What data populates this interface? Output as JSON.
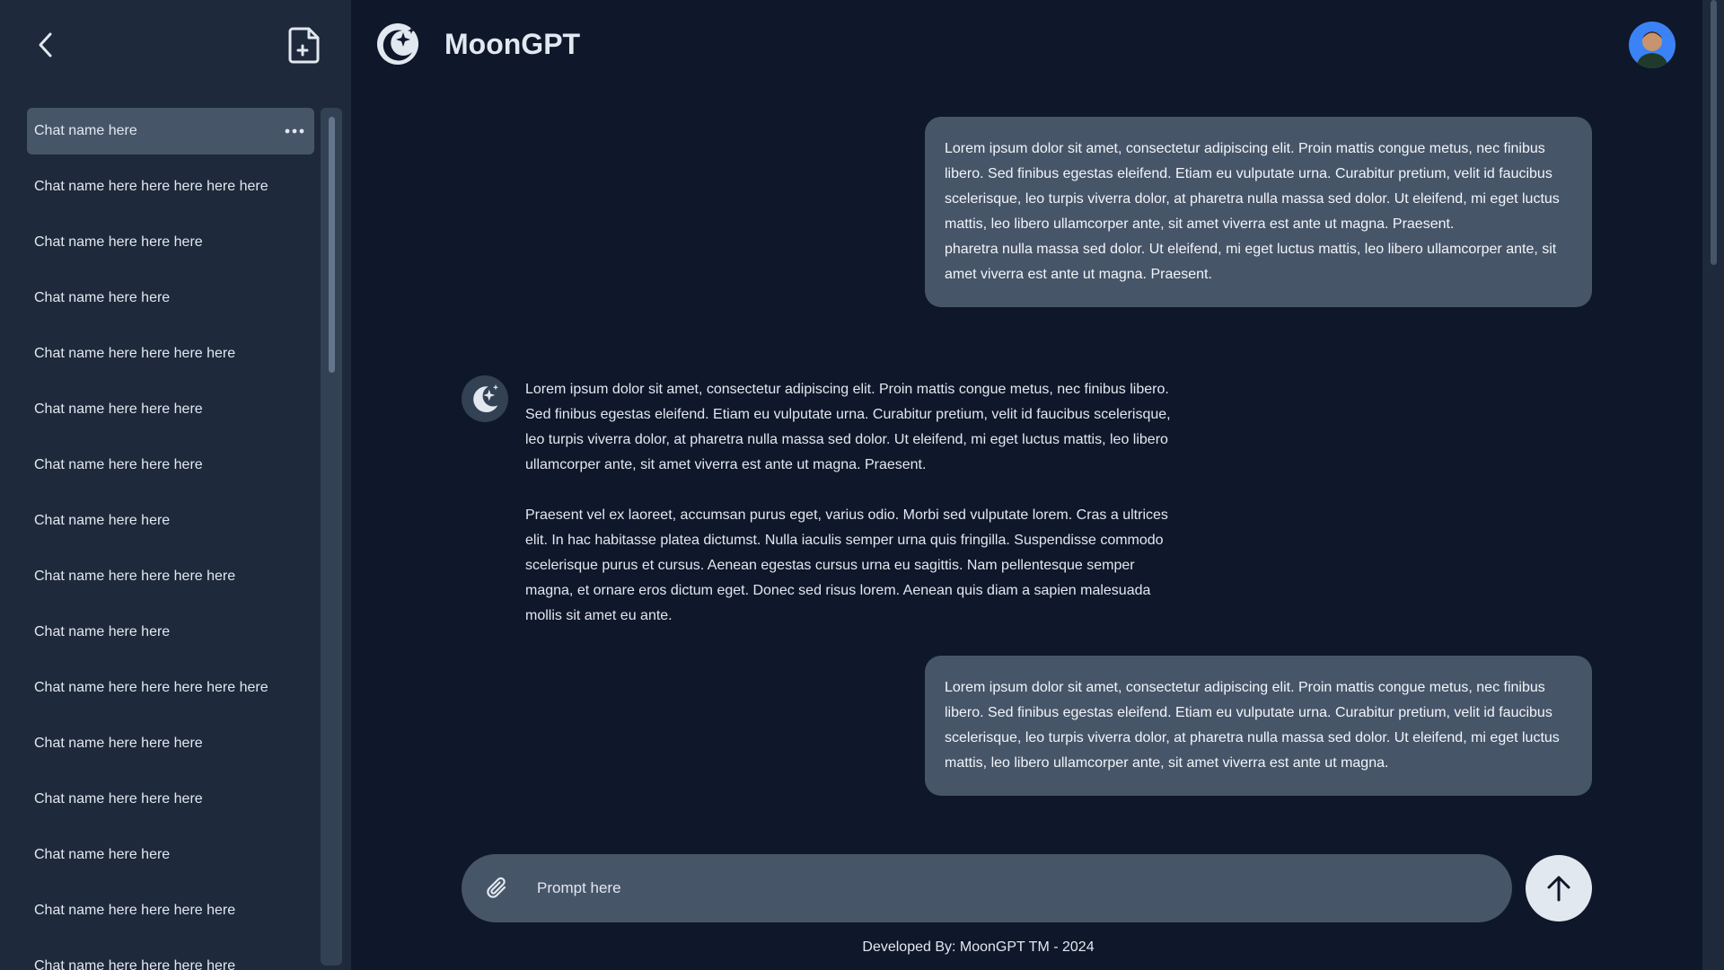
{
  "app": {
    "title": "MoonGPT"
  },
  "sidebar": {
    "chats": [
      "Chat name here",
      "Chat name here here here here here",
      "Chat name here here here",
      "Chat name here here",
      "Chat name here here here here",
      "Chat name here here here",
      "Chat name here here here",
      "Chat name here here",
      "Chat name here here here here",
      "Chat name here here",
      "Chat name here here here here here",
      "Chat name here here here",
      "Chat name here here here",
      "Chat name here here",
      "Chat name here here here here",
      "Chat name here here here here"
    ],
    "active_index": 0
  },
  "messages": {
    "user_1": "Lorem ipsum dolor sit amet, consectetur adipiscing elit. Proin mattis congue metus, nec finibus libero. Sed finibus egestas eleifend. Etiam eu vulputate urna. Curabitur pretium, velit id faucibus scelerisque, leo turpis viverra dolor, at pharetra nulla massa sed dolor. Ut eleifend, mi eget luctus mattis, leo libero ullamcorper ante, sit amet viverra est ante ut magna. Praesent.\npharetra nulla massa sed dolor. Ut eleifend, mi eget luctus mattis, leo libero ullamcorper ante, sit amet viverra est ante ut magna. Praesent.",
    "bot_1_p1": "Lorem ipsum dolor sit amet, consectetur adipiscing elit. Proin mattis congue metus, nec finibus libero. Sed finibus egestas eleifend. Etiam eu vulputate urna. Curabitur pretium, velit id faucibus scelerisque, leo turpis viverra dolor, at pharetra nulla massa sed dolor. Ut eleifend, mi eget luctus mattis, leo libero ullamcorper ante, sit amet viverra est ante ut magna. Praesent.",
    "bot_1_p2": "Praesent vel ex laoreet, accumsan purus eget, varius odio. Morbi sed vulputate lorem. Cras a ultrices elit. In hac habitasse platea dictumst. Nulla iaculis semper urna quis fringilla. Suspendisse commodo scelerisque purus et cursus. Aenean egestas cursus urna eu sagittis. Nam pellentesque semper magna, et ornare eros dictum eget. Donec sed risus lorem. Aenean quis diam a sapien malesuada mollis sit amet eu ante.",
    "user_2": "Lorem ipsum dolor sit amet, consectetur adipiscing elit. Proin mattis congue metus, nec finibus libero. Sed finibus egestas eleifend. Etiam eu vulputate urna. Curabitur pretium, velit id faucibus scelerisque, leo turpis viverra dolor, at pharetra nulla massa sed dolor. Ut eleifend, mi eget luctus mattis, leo libero ullamcorper ante, sit amet viverra est ante ut magna."
  },
  "prompt": {
    "placeholder": "Prompt here"
  },
  "footer": {
    "text": "Developed By: MoonGPT TM - 2024"
  },
  "icons": {
    "back": "chevron-left-icon",
    "new_chat": "file-plus-icon",
    "more": "ellipsis-icon",
    "brand": "moon-stars-icon",
    "attach": "paperclip-icon",
    "send": "arrow-up-icon"
  },
  "colors": {
    "background": "#0f172a",
    "sidebar": "#1e293b",
    "bubble": "#475569",
    "text": "#e2e8f0"
  }
}
